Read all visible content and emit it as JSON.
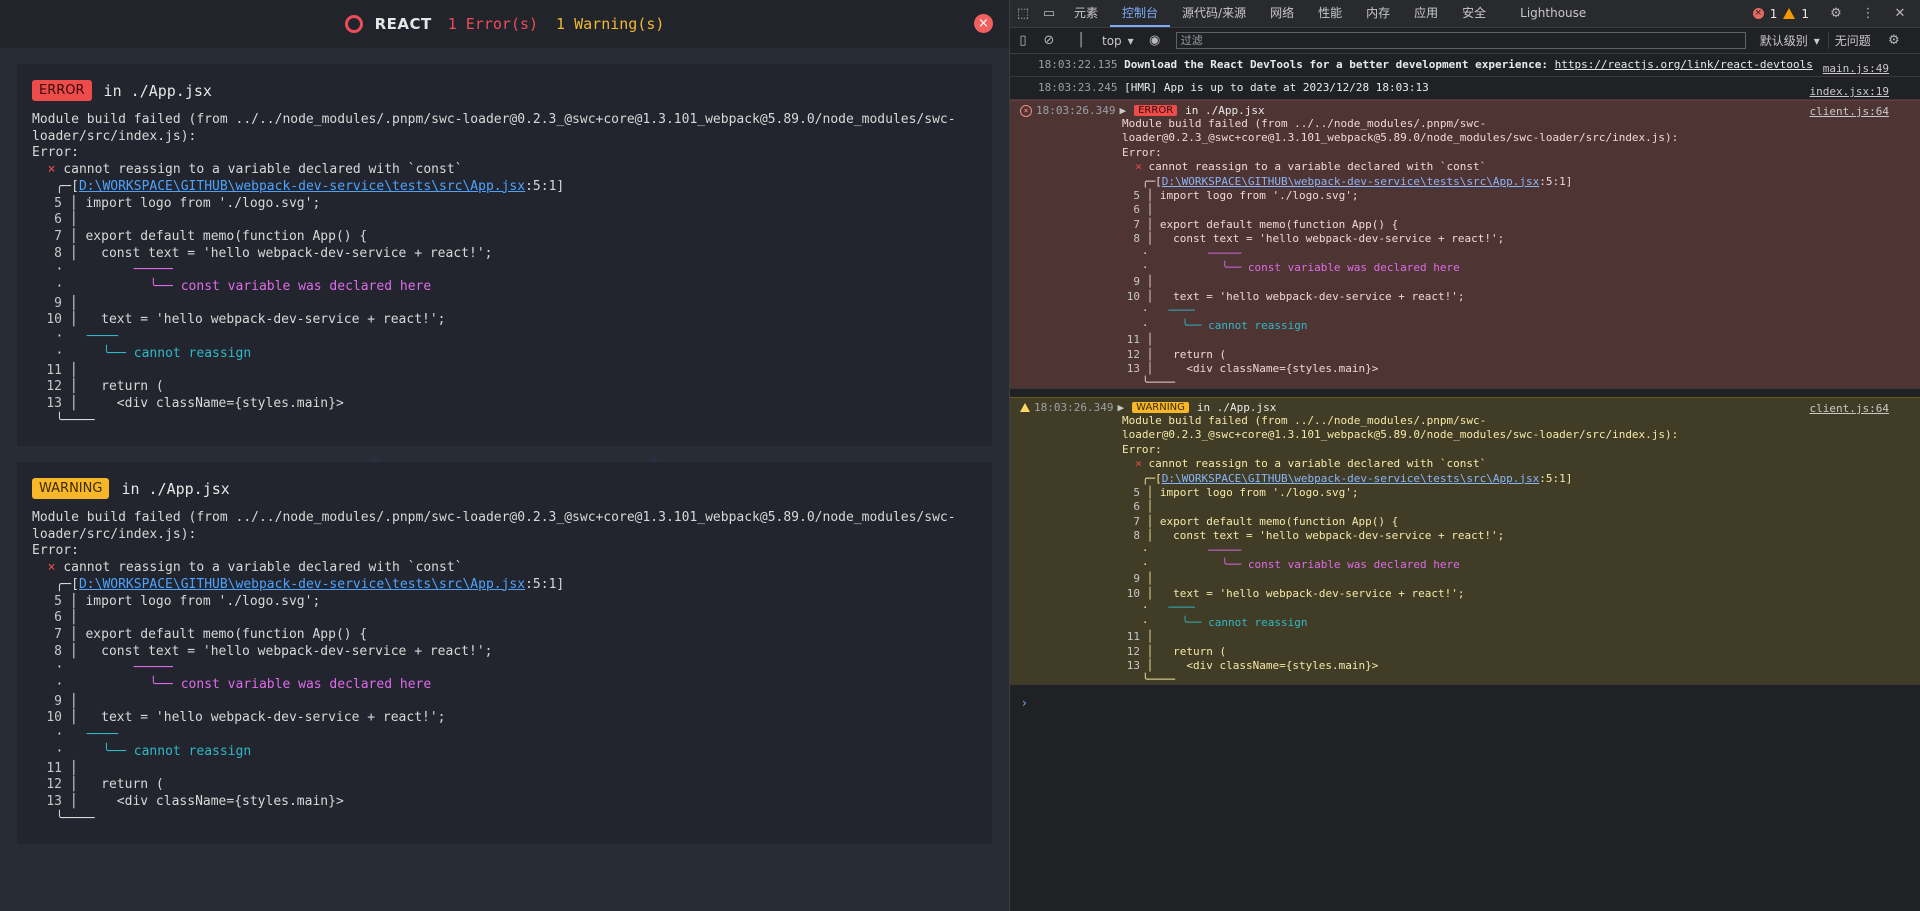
{
  "overlay": {
    "title": "REACT",
    "error_count": "1 Error(s)",
    "warning_count": "1 Warning(s)",
    "close": "×",
    "cards": [
      {
        "badge": "ERROR",
        "file": "in ./App.jsx",
        "lines": [
          "Module build failed (from ../../node_modules/.pnpm/swc-loader@0.2.3_@swc+core@1.3.101_webpack@5.89.0/node_modules/swc-",
          "loader/src/index.js):",
          "Error:",
          "cannot reassign to a variable declared with `const`",
          "D:\\WORKSPACE\\GITHUB\\webpack-dev-service\\tests\\src\\App.jsx",
          ":5:1]"
        ]
      },
      {
        "badge": "WARNING",
        "file": "in ./App.jsx",
        "lines": [
          "Module build failed (from ../../node_modules/.pnpm/swc-loader@0.2.3_@swc+core@1.3.101_webpack@5.89.0/node_modules/swc-",
          "loader/src/index.js):",
          "Error:",
          "cannot reassign to a variable declared with `const`",
          "D:\\WORKSPACE\\GITHUB\\webpack-dev-service\\tests\\src\\App.jsx",
          ":5:1]"
        ]
      }
    ],
    "code": {
      "l5": "import logo from './logo.svg';",
      "l7": "export default memo(function App() {",
      "l8": "const text = 'hello webpack-dev-service + react!';",
      "note_const": "const variable was declared here",
      "l10": "text = 'hello webpack-dev-service + react!';",
      "note_reassign": "cannot reassign",
      "l12": "return (",
      "l13": "<div className={styles.main}>"
    }
  },
  "devtools": {
    "tabs": [
      "元素",
      "控制台",
      "源代码/来源",
      "网络",
      "性能",
      "内存",
      "应用",
      "安全",
      "Lighthouse"
    ],
    "active_tab": "控制台",
    "error_count": "1",
    "warning_count": "1",
    "context": "top",
    "filter_placeholder": "过滤",
    "level": "默认级别",
    "issues": "无问题",
    "messages": [
      {
        "time": "18:03:22.135",
        "text": "Download the React DevTools for a better development experience: ",
        "link": "https://reactjs.org/link/react-devtools",
        "src": "main.js:49"
      },
      {
        "time": "18:03:23.245",
        "text": "[HMR] App is up to date at 2023/12/28 18:03:13",
        "src": "index.jsx:19"
      },
      {
        "time": "18:03:26.349",
        "badge": "ERROR",
        "file": "in ./App.jsx",
        "src": "client.js:64"
      },
      {
        "time": "18:03:26.349",
        "badge": "WARNING",
        "file": "in ./App.jsx",
        "src": "client.js:64"
      }
    ],
    "dt_lines": [
      "Module build failed (from ../../node_modules/.pnpm/swc-",
      "loader@0.2.3_@swc+core@1.3.101_webpack@5.89.0/node_modules/swc-loader/src/index.js):"
    ],
    "prompt": "›"
  }
}
